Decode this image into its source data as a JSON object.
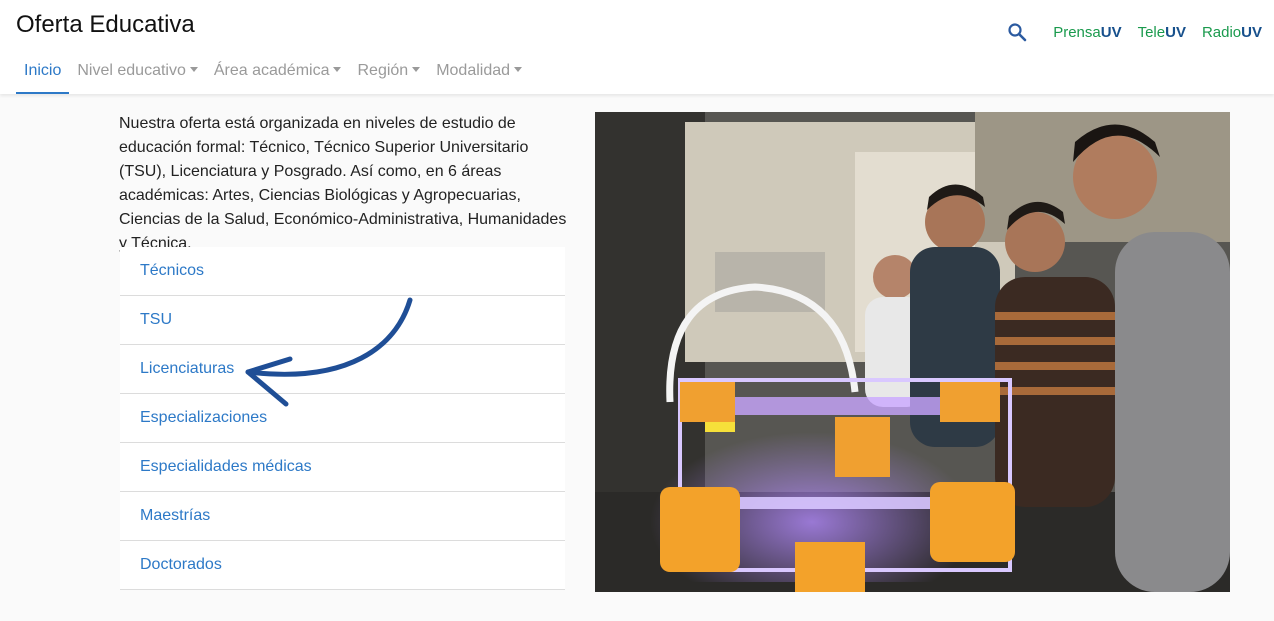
{
  "header": {
    "title": "Oferta Educativa",
    "nav": [
      {
        "label": "Inicio"
      },
      {
        "label": "Nivel educativo"
      },
      {
        "label": "Área académica"
      },
      {
        "label": "Región"
      },
      {
        "label": "Modalidad"
      }
    ],
    "brands": [
      {
        "prefix": "Prensa",
        "suffix": "UV"
      },
      {
        "prefix": "Tele",
        "suffix": "UV"
      },
      {
        "prefix": "Radio",
        "suffix": "UV"
      }
    ],
    "search_icon": "search-icon"
  },
  "main": {
    "intro": "Nuestra oferta está organizada en niveles de estudio de educación formal: Técnico, Técnico Superior Universitario (TSU), Licenciatura y Posgrado. Así como, en 6 áreas académicas: Artes, Ciencias Biológicas y Agropecuarias, Ciencias de la Salud, Económico-Administrativa, Humanidades y Técnica.",
    "levels": [
      {
        "label": "Técnicos"
      },
      {
        "label": "TSU"
      },
      {
        "label": "Licenciaturas"
      },
      {
        "label": "Especializaciones"
      },
      {
        "label": "Especialidades médicas"
      },
      {
        "label": "Maestrías"
      },
      {
        "label": "Doctorados"
      }
    ]
  },
  "colors": {
    "accent": "#2d79c7",
    "brand_green": "#1a9a4d",
    "brand_blue": "#17508c",
    "arrow": "#1f4e96"
  }
}
